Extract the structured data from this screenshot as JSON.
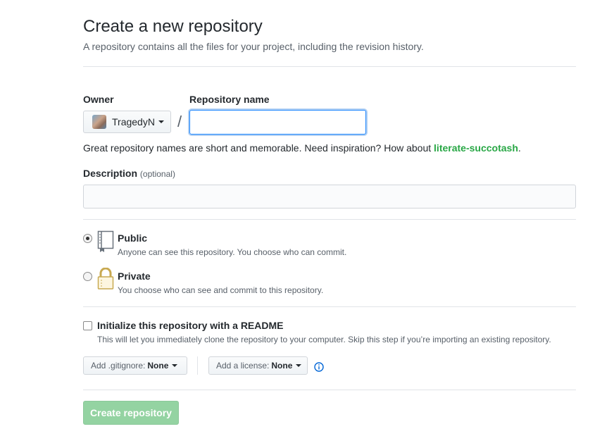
{
  "header": {
    "title": "Create a new repository",
    "subtitle": "A repository contains all the files for your project, including the revision history."
  },
  "owner": {
    "label": "Owner",
    "selected": "TragedyN",
    "avatar_icon": "user-avatar",
    "separator": "/"
  },
  "repo_name": {
    "label": "Repository name",
    "value": "",
    "placeholder": ""
  },
  "hint": {
    "text": "Great repository names are short and memorable. Need inspiration? How about ",
    "suggestion": "literate-succotash",
    "suffix": "."
  },
  "description": {
    "label": "Description",
    "optional": "(optional)",
    "value": "",
    "placeholder": ""
  },
  "visibility": {
    "public": {
      "title": "Public",
      "note": "Anyone can see this repository. You choose who can commit.",
      "checked": true,
      "icon": "repo-book-icon"
    },
    "private": {
      "title": "Private",
      "note": "You choose who can see and commit to this repository.",
      "checked": false,
      "icon": "lock-icon"
    }
  },
  "readme": {
    "title": "Initialize this repository with a README",
    "note": "This will let you immediately clone the repository to your computer. Skip this step if you’re importing an existing repository.",
    "checked": false
  },
  "gitignore": {
    "label": "Add .gitignore:",
    "value": "None"
  },
  "license": {
    "label": "Add a license:",
    "value": "None"
  },
  "submit": {
    "label": "Create repository"
  },
  "colors": {
    "link_green": "#28a745",
    "focus_blue": "#2188ff",
    "disabled_button": "#94d3a2",
    "info_blue": "#0366d6",
    "lock_gold": "#c8a951"
  }
}
